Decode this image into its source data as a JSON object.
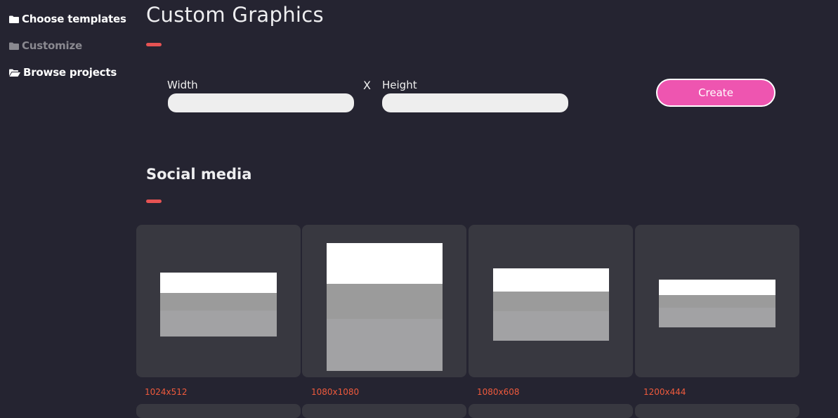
{
  "sidebar": {
    "items": [
      {
        "label": "Choose templates",
        "icon": "folder-icon",
        "state": "active"
      },
      {
        "label": "Customize",
        "icon": "folder-icon",
        "state": "disabled"
      },
      {
        "label": "Browse projects",
        "icon": "folder-open-icon",
        "state": "active"
      }
    ]
  },
  "main": {
    "title": "Custom Graphics",
    "form": {
      "width_label": "Width",
      "width_value": "",
      "width_placeholder": "",
      "separator": "X",
      "height_label": "Height",
      "height_value": "",
      "height_placeholder": "",
      "create_label": "Create"
    },
    "section": {
      "title": "Social media",
      "templates": [
        {
          "label": "1024x512"
        },
        {
          "label": "1080x1080"
        },
        {
          "label": "1080x608"
        },
        {
          "label": "1200x444"
        }
      ]
    }
  },
  "colors": {
    "background": "#252431",
    "card": "#383840",
    "accent_bar": "#e65353",
    "create_button": "#ee55b0",
    "size_label": "#ef5a3c",
    "disabled_text": "#8a8990"
  }
}
